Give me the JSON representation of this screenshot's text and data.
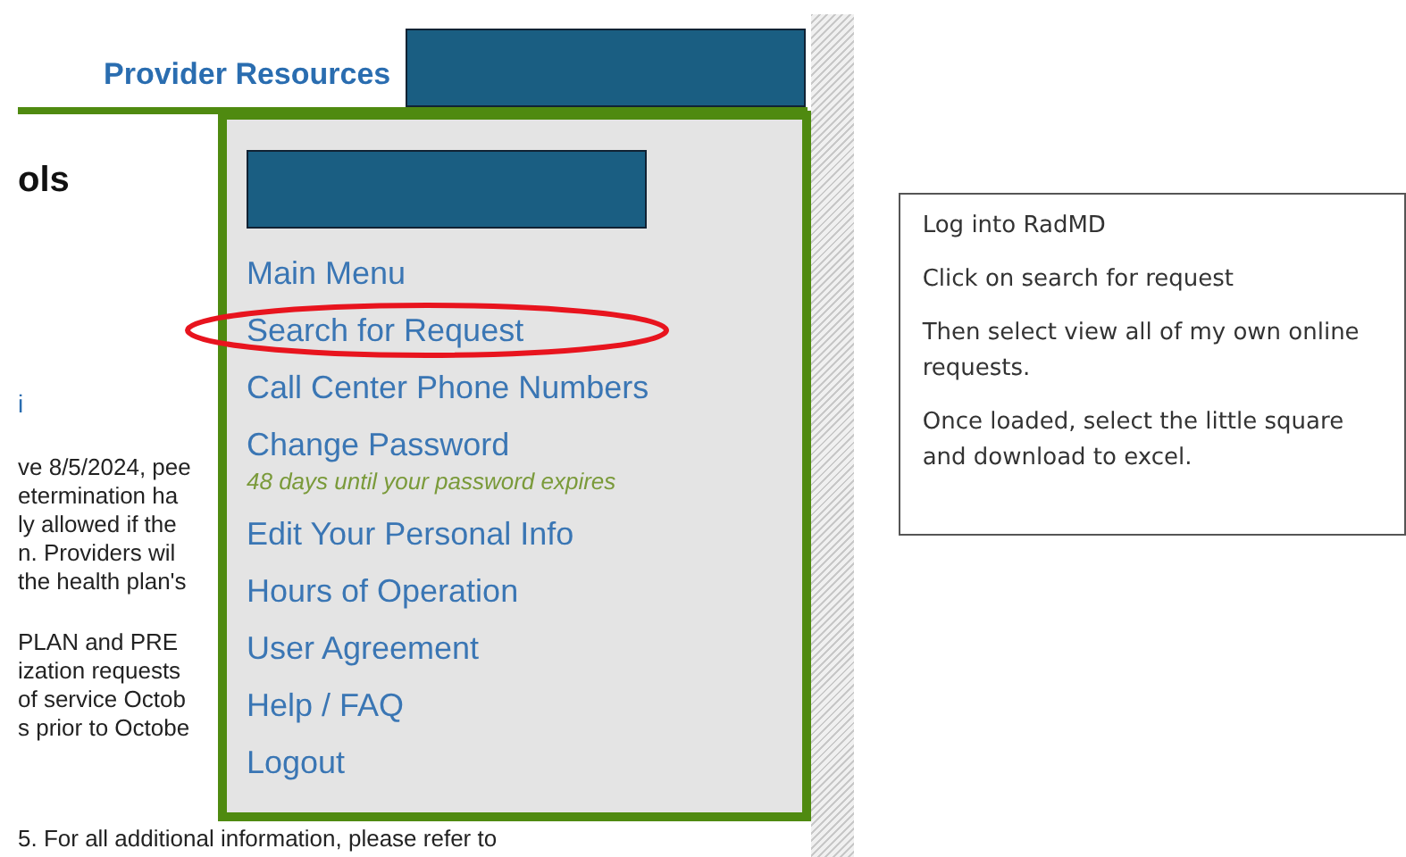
{
  "header": {
    "title": "Provider Resources"
  },
  "page": {
    "heading": "ols",
    "fragment": "i",
    "paragraphs": [
      [
        "ve 8/5/2024, pee",
        "etermination ha",
        "ly allowed if the",
        "n. Providers wil",
        "the health plan's"
      ],
      [
        "PLAN and PRE",
        "ization requests",
        "of service Octob",
        "s prior to Octobe"
      ]
    ],
    "last_line": "5. For all additional information, please refer to"
  },
  "menu": {
    "items": [
      {
        "kind": "link",
        "label": "Main Menu",
        "circled": false
      },
      {
        "kind": "link",
        "label": "Search for Request",
        "circled": true
      },
      {
        "kind": "link",
        "label": "Call Center Phone Numbers",
        "circled": false
      },
      {
        "kind": "link",
        "label": "Change Password",
        "circled": false
      },
      {
        "kind": "hint",
        "label": "48 days until your password expires"
      },
      {
        "kind": "link",
        "label": "Edit Your Personal Info",
        "circled": false
      },
      {
        "kind": "link",
        "label": "Hours of Operation",
        "circled": false
      },
      {
        "kind": "link",
        "label": "User Agreement",
        "circled": false
      },
      {
        "kind": "link",
        "label": "Help / FAQ",
        "circled": false
      },
      {
        "kind": "link",
        "label": "Logout",
        "circled": false
      }
    ]
  },
  "note": {
    "paragraphs": [
      "Log into RadMD",
      "Click on search for request",
      "Then select view all of my own online requests.",
      "Once loaded, select the little square and download to excel."
    ]
  }
}
